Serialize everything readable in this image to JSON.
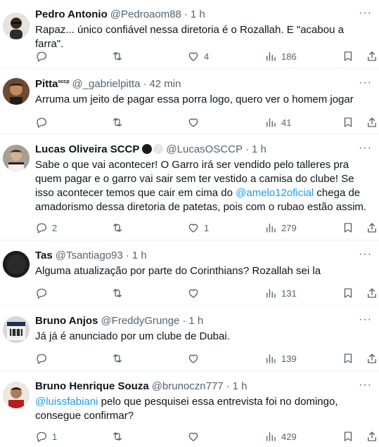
{
  "replies": [
    {
      "name": "Pedro Antonio",
      "handle": "@Pedroaom88",
      "time": "1 h",
      "text": "Rapaz... único confiável nessa diretoria é o Rozallah. E \"acabou a farra\".",
      "reply_count": "",
      "like_count": "4",
      "view_count": "186"
    },
    {
      "name": "Pitta",
      "name_sup": "sccp",
      "handle": "@_gabrielpitta",
      "time": "42 min",
      "text": "Arruma um jeito de pagar essa porra logo, quero ver o homem jogar",
      "reply_count": "",
      "like_count": "",
      "view_count": "41"
    },
    {
      "name": "Lucas Oliveira SCCP",
      "handle": "@LucasOSCCP",
      "time": "1 h",
      "text_parts": [
        "Sabe o que vai acontecer! O Garro irá ser vendido pelo talleres pra quem pagar e o garro vai sair sem ter vestido a camisa do clube! Se isso acontecer temos que cair em cima do ",
        "@amelo12oficial",
        " chega de amadorismo dessa diretoria de patetas, pois com o rubao estão assim."
      ],
      "reply_count": "2",
      "like_count": "1",
      "view_count": "279"
    },
    {
      "name": "Tas",
      "handle": "@Tsantiago93",
      "time": "1 h",
      "text": "Alguma atualização por parte do Corinthians? Rozallah sei la",
      "reply_count": "",
      "like_count": "",
      "view_count": "131"
    },
    {
      "name": "Bruno Anjos",
      "handle": "@FreddyGrunge",
      "time": "1 h",
      "text": "Já já é anunciado por um clube de Dubai.",
      "reply_count": "",
      "like_count": "",
      "view_count": "139"
    },
    {
      "name": "Bruno Henrique Souza",
      "handle": "@brunoczn777",
      "time": "1 h",
      "text_parts": [
        "",
        "@luissfabiani",
        " pelo que pesquisei essa entrevista foi no domingo, consegue confirmar?"
      ],
      "reply_count": "1",
      "like_count": "",
      "view_count": "429"
    }
  ],
  "separator": "·",
  "more_glyph": "···",
  "colors": {
    "text": "#0f1419",
    "secondary": "#536471",
    "link": "#1d9bf0",
    "divider": "#eff3f4"
  },
  "icons": [
    "reply-icon",
    "retweet-icon",
    "like-icon",
    "views-icon",
    "bookmark-icon",
    "share-icon",
    "more-icon"
  ]
}
